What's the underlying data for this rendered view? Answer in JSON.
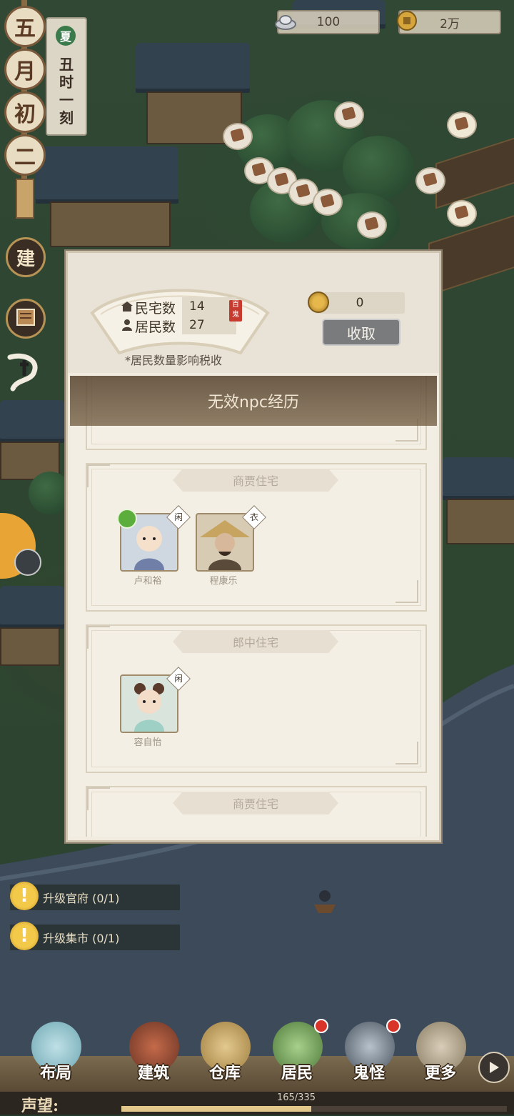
{
  "resources": {
    "silver_value": "100",
    "copper_value": "2万",
    "silver_icon": "silver-ingot-icon",
    "copper_icon": "copper-coin-icon"
  },
  "date": {
    "chars": [
      "五",
      "月",
      "初",
      "二"
    ],
    "season": "夏",
    "time_chars": [
      "丑",
      "时",
      "一",
      "刻"
    ]
  },
  "side_buttons": {
    "build_label": "建"
  },
  "dialog": {
    "house_label": "民宅数",
    "house_count": "14",
    "resident_label": "居民数",
    "resident_count": "27",
    "seal_text": "百鬼",
    "coin_amount": "0",
    "collect_label": "收取",
    "note": "*居民数量影响税收",
    "banner": "无效npc经历",
    "sections": [
      {
        "title": "商贾住宅",
        "residents": [
          {
            "name": "卢和裕",
            "tag": "闲",
            "has_alert": true
          },
          {
            "name": "程康乐",
            "tag": "衣",
            "has_alert": false
          }
        ]
      },
      {
        "title": "郎中住宅",
        "residents": [
          {
            "name": "容自怡",
            "tag": "闲",
            "has_alert": false
          }
        ]
      },
      {
        "title": "商贾住宅",
        "residents": []
      }
    ]
  },
  "quests": [
    {
      "label": "升级官府 (0/1)"
    },
    {
      "label": "升级集市 (0/1)"
    }
  ],
  "nav": [
    {
      "label": "布局",
      "badge": false
    },
    {
      "label": "建筑",
      "badge": false
    },
    {
      "label": "仓库",
      "badge": false
    },
    {
      "label": "居民",
      "badge": true
    },
    {
      "label": "鬼怪",
      "badge": true
    },
    {
      "label": "更多",
      "badge": false
    }
  ],
  "reputation": {
    "label": "声望:",
    "progress": "165/335",
    "fraction": 0.4925
  },
  "colors": {
    "dialog_bg": "#f2ece0",
    "banner_bg": "#5a4630",
    "collect_button": "#7a7b7d",
    "badge_red": "#d9342a",
    "quest_icon": "#f3c94a"
  }
}
